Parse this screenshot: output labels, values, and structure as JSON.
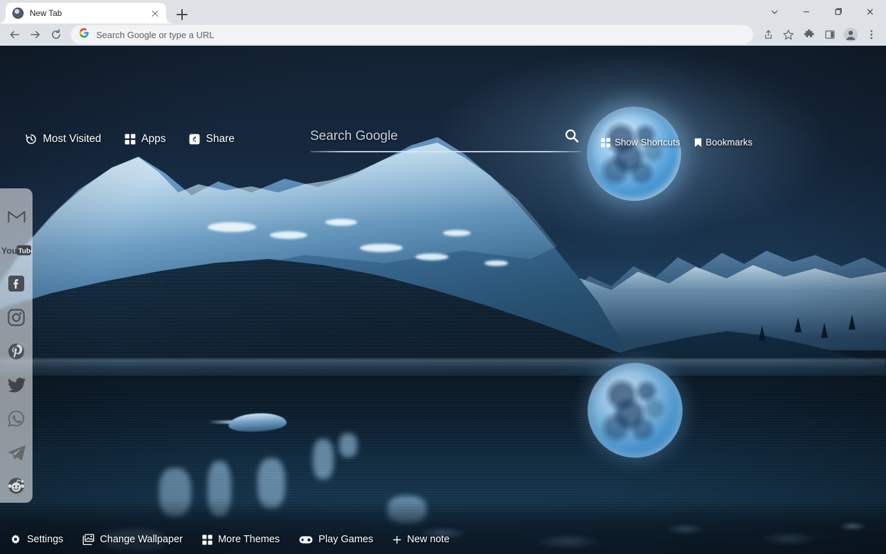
{
  "browser": {
    "tab": {
      "title": "New Tab",
      "favicon": "globe-icon",
      "close": "close-icon"
    },
    "new_tab_button": "new-tab-icon",
    "window_controls": [
      {
        "name": "tab-search",
        "glyph": "chevron-down-icon"
      },
      {
        "name": "minimize",
        "glyph": "minimize-icon"
      },
      {
        "name": "maximize",
        "glyph": "maximize-icon"
      },
      {
        "name": "close",
        "glyph": "window-close-icon"
      }
    ],
    "nav": {
      "back": "back-arrow-icon",
      "forward": "forward-arrow-icon",
      "reload": "reload-icon"
    },
    "omnibox": {
      "placeholder": "Search Google or type a URL",
      "value": "",
      "leading_icon": "google-g-icon"
    },
    "toolbar_icons": [
      {
        "name": "share-icon"
      },
      {
        "name": "bookmark-star-icon"
      },
      {
        "name": "extensions-puzzle-icon"
      },
      {
        "name": "side-panel-icon"
      },
      {
        "name": "profile-avatar-icon"
      },
      {
        "name": "chrome-menu-icon"
      }
    ]
  },
  "newtab": {
    "top_nav": [
      {
        "label": "Most Visited",
        "icon": "history-clock-icon"
      },
      {
        "label": "Apps",
        "icon": "apps-grid-icon"
      },
      {
        "label": "Share",
        "icon": "share-icon"
      }
    ],
    "search": {
      "placeholder": "Search Google",
      "value": "",
      "submit_icon": "search-magnifier-icon"
    },
    "right_links": [
      {
        "label": "Show Shortcuts",
        "icon": "grid-icon"
      },
      {
        "label": "Bookmarks",
        "icon": "bookmark-flag-icon"
      }
    ],
    "social_sidebar": [
      {
        "label": "Gmail",
        "icon": "gmail-icon"
      },
      {
        "label": "YouTube",
        "icon": "youtube-icon"
      },
      {
        "label": "Facebook",
        "icon": "facebook-icon"
      },
      {
        "label": "Instagram",
        "icon": "instagram-icon"
      },
      {
        "label": "Pinterest",
        "icon": "pinterest-icon"
      },
      {
        "label": "Twitter",
        "icon": "twitter-icon"
      },
      {
        "label": "WhatsApp",
        "icon": "whatsapp-icon"
      },
      {
        "label": "Telegram",
        "icon": "telegram-icon"
      },
      {
        "label": "Reddit",
        "icon": "reddit-icon"
      }
    ],
    "bottom_bar": [
      {
        "label": "Settings",
        "icon": "gear-icon"
      },
      {
        "label": "Change Wallpaper",
        "icon": "image-icon"
      },
      {
        "label": "More Themes",
        "icon": "grid-icon"
      },
      {
        "label": "Play Games",
        "icon": "gamepad-icon"
      },
      {
        "label": "New note",
        "icon": "plus-icon"
      }
    ],
    "wallpaper": {
      "description": "Moonlit snowy mountain lake at night",
      "sky_color": "#16293f",
      "water_color": "#112c41",
      "moon_color": "#8fc4ea",
      "snow_color": "#e6f3ff"
    }
  }
}
